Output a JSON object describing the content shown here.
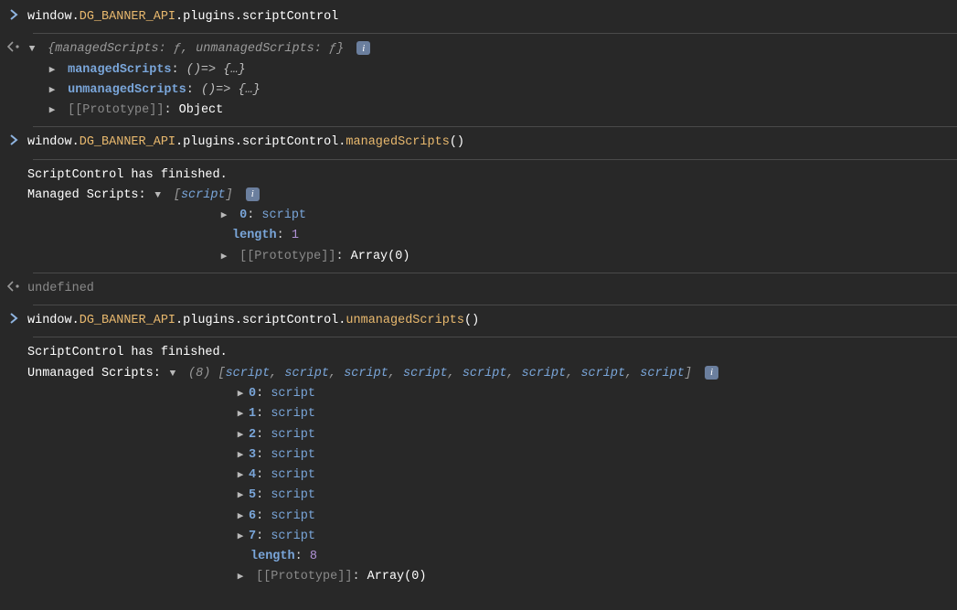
{
  "cmd1": {
    "prefix": "window",
    "obj": "DG_BANNER_API",
    "path": ".plugins.scriptControl"
  },
  "result1": {
    "summary_open": "{",
    "summary_k1": "managedScripts: ",
    "summary_v1": "ƒ",
    "summary_sep": ", ",
    "summary_k2": "unmanagedScripts: ",
    "summary_v2": "ƒ",
    "summary_close": "}",
    "prop1_key": "managedScripts",
    "prop1_val": "()=> {…}",
    "prop2_key": "unmanagedScripts",
    "prop2_val": "()=> {…}",
    "proto_key": "[[Prototype]]",
    "proto_val": "Object"
  },
  "cmd2": {
    "prefix": "window",
    "obj": "DG_BANNER_API",
    "path": ".plugins.scriptControl.",
    "method": "managedScripts",
    "call": "()"
  },
  "result2": {
    "line1": "ScriptControl has finished.",
    "label": " Managed Scripts: ",
    "arr_open": "[",
    "arr_item": "script",
    "arr_close": "]",
    "item0_key": "0",
    "item0_val": "script",
    "length_key": "length",
    "length_val": "1",
    "proto_key": "[[Prototype]]",
    "proto_val": "Array(0)"
  },
  "undef": "undefined",
  "cmd3": {
    "prefix": "window",
    "obj": "DG_BANNER_API",
    "path": ".plugins.scriptControl.",
    "method": "unmanagedScripts",
    "call": "()"
  },
  "result3": {
    "line1": "ScriptControl has finished.",
    "label": " Unmanaged Scripts: ",
    "count": "(8)",
    "arr_open": " [",
    "item": "script",
    "sep": ", ",
    "arr_close": "]",
    "items": [
      {
        "key": "0",
        "val": "script"
      },
      {
        "key": "1",
        "val": "script"
      },
      {
        "key": "2",
        "val": "script"
      },
      {
        "key": "3",
        "val": "script"
      },
      {
        "key": "4",
        "val": "script"
      },
      {
        "key": "5",
        "val": "script"
      },
      {
        "key": "6",
        "val": "script"
      },
      {
        "key": "7",
        "val": "script"
      }
    ],
    "length_key": "length",
    "length_val": "8",
    "proto_key": "[[Prototype]]",
    "proto_val": "Array(0)"
  },
  "glyphs": {
    "colon": ": ",
    "dot": ".",
    "info": "i"
  }
}
